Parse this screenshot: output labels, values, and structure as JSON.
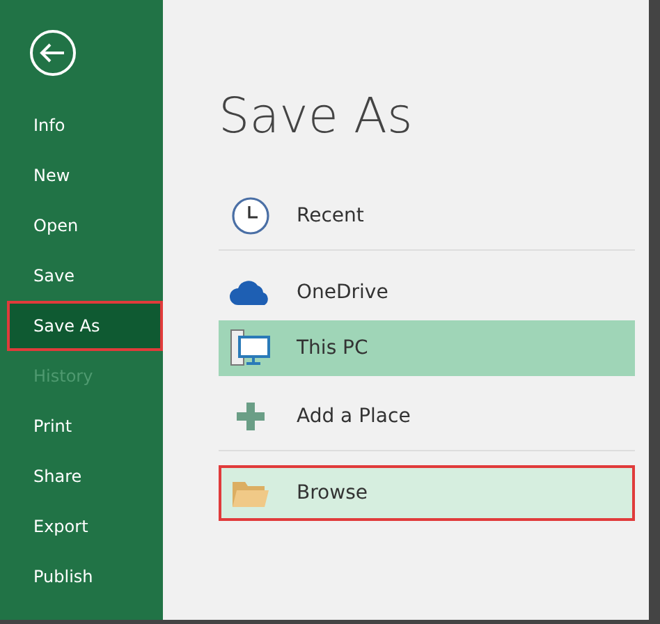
{
  "sidebar": {
    "items": [
      {
        "label": "Info",
        "selected": false,
        "disabled": false,
        "outlined": false
      },
      {
        "label": "New",
        "selected": false,
        "disabled": false,
        "outlined": false
      },
      {
        "label": "Open",
        "selected": false,
        "disabled": false,
        "outlined": false
      },
      {
        "label": "Save",
        "selected": false,
        "disabled": false,
        "outlined": false
      },
      {
        "label": "Save As",
        "selected": true,
        "disabled": false,
        "outlined": true
      },
      {
        "label": "History",
        "selected": false,
        "disabled": true,
        "outlined": false
      },
      {
        "label": "Print",
        "selected": false,
        "disabled": false,
        "outlined": false
      },
      {
        "label": "Share",
        "selected": false,
        "disabled": false,
        "outlined": false
      },
      {
        "label": "Export",
        "selected": false,
        "disabled": false,
        "outlined": false
      },
      {
        "label": "Publish",
        "selected": false,
        "disabled": false,
        "outlined": false
      }
    ]
  },
  "title": "Save As",
  "places": [
    {
      "kind": "recent",
      "label": "Recent",
      "selected": false,
      "hovered": false,
      "outlined": false,
      "divider_after": true
    },
    {
      "kind": "onedrive",
      "label": "OneDrive",
      "selected": false,
      "hovered": false,
      "outlined": false,
      "divider_after": false
    },
    {
      "kind": "pc",
      "label": "This PC",
      "selected": true,
      "hovered": false,
      "outlined": false,
      "divider_after": false
    },
    {
      "kind": "add",
      "label": "Add a Place",
      "selected": false,
      "hovered": false,
      "outlined": false,
      "divider_after": true
    },
    {
      "kind": "browse",
      "label": "Browse",
      "selected": false,
      "hovered": true,
      "outlined": true,
      "divider_after": false
    }
  ]
}
